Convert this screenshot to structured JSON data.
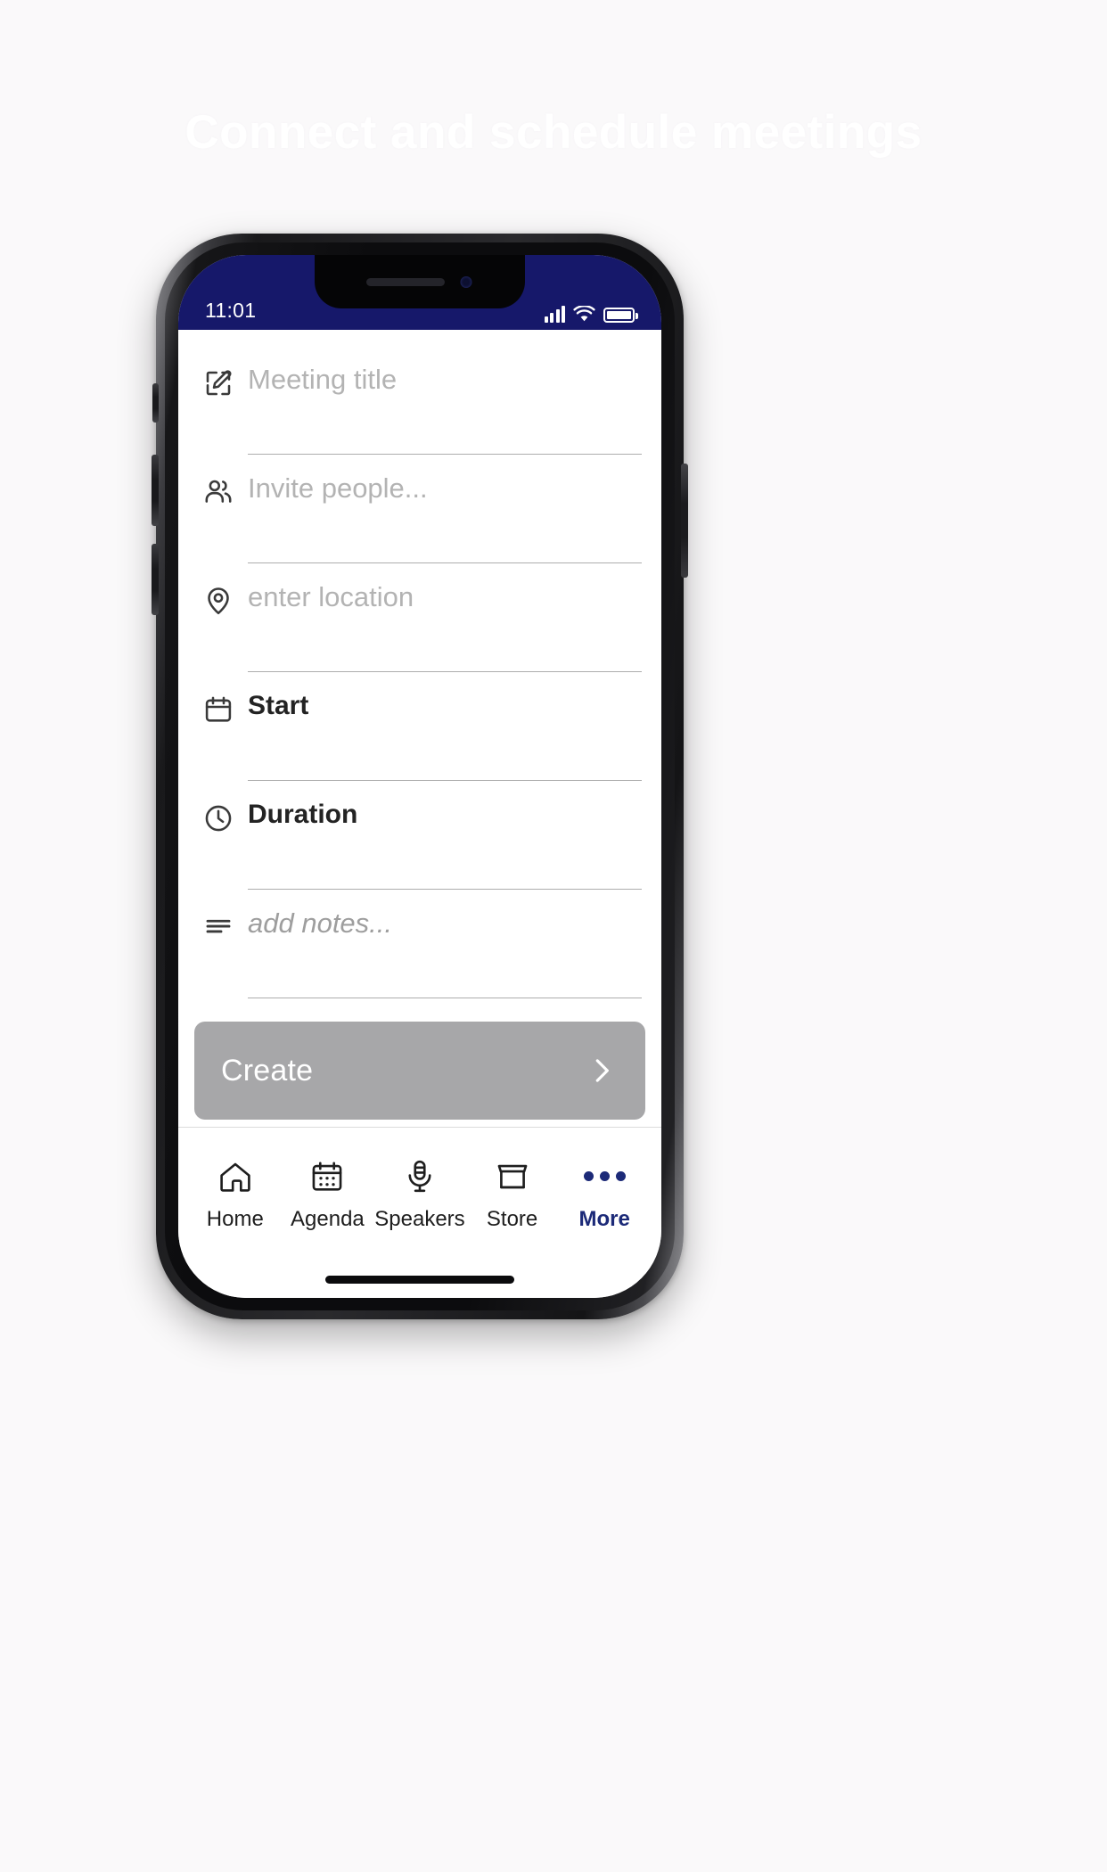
{
  "page": {
    "background_headline": "Connect and schedule meetings",
    "background_color": "#faf9fa"
  },
  "device": {
    "status_bar": {
      "time": "11:01",
      "background_color": "#16186a",
      "text_color": "#ffffff",
      "icons": [
        "cellular-signal-icon",
        "wifi-icon",
        "battery-icon"
      ]
    }
  },
  "form": {
    "fields": [
      {
        "icon": "edit-square-icon",
        "placeholder": "Meeting title",
        "value": "",
        "style": "placeholder"
      },
      {
        "icon": "people-icon",
        "placeholder": "Invite people...",
        "value": "",
        "style": "placeholder"
      },
      {
        "icon": "map-pin-icon",
        "placeholder": "enter location",
        "value": "",
        "style": "placeholder"
      },
      {
        "icon": "calendar-icon",
        "placeholder": "Start",
        "value": "Start",
        "style": "label"
      },
      {
        "icon": "clock-icon",
        "placeholder": "Duration",
        "value": "Duration",
        "style": "label"
      },
      {
        "icon": "notes-lines-icon",
        "placeholder": "add notes...",
        "value": "",
        "style": "placeholder-italic"
      }
    ],
    "submit": {
      "label": "Create",
      "background_color": "#a7a7a9",
      "text_color": "#ffffff",
      "arrow_icon": "chevron-right-icon"
    }
  },
  "tabbar": {
    "active_color": "#1c2a78",
    "inactive_color": "#1e1e1e",
    "items": [
      {
        "label": "Home",
        "icon": "home-icon",
        "active": false
      },
      {
        "label": "Agenda",
        "icon": "calendar-icon",
        "active": false
      },
      {
        "label": "Speakers",
        "icon": "microphone-icon",
        "active": false
      },
      {
        "label": "Store",
        "icon": "storefront-icon",
        "active": false
      },
      {
        "label": "More",
        "icon": "ellipsis-icon",
        "active": true
      }
    ]
  }
}
